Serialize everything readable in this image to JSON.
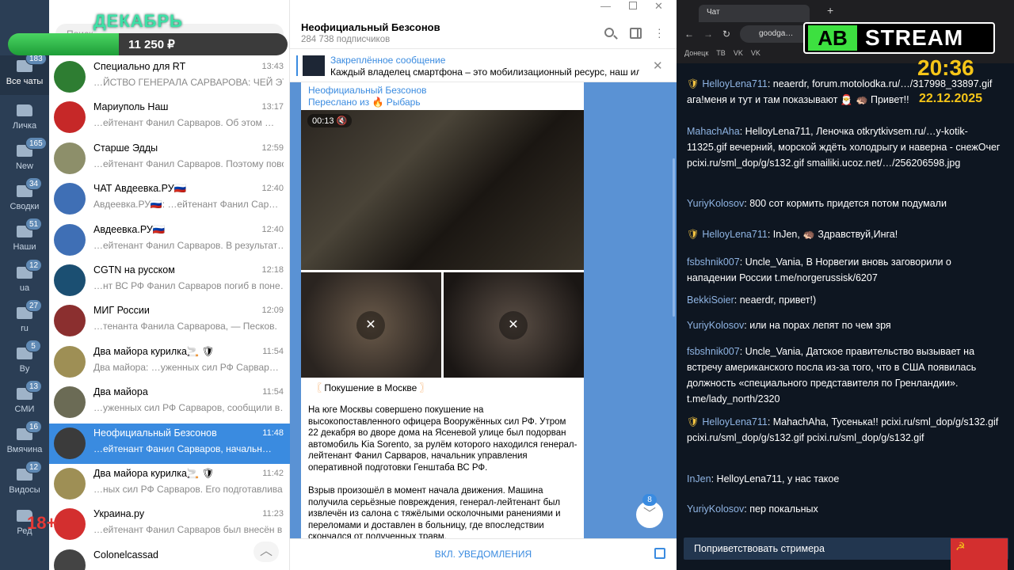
{
  "overlay": {
    "month": "ДЕКАБРЬ",
    "amount": "11 250 ₽",
    "age": "18+",
    "stream_logo_left": "AB",
    "stream_logo_right": "STREAM",
    "clock": "20:36",
    "date": "22.12.2025"
  },
  "folders": [
    {
      "label": "Все чаты",
      "badge": "183"
    },
    {
      "label": "Личка",
      "badge": ""
    },
    {
      "label": "New",
      "badge": "165"
    },
    {
      "label": "Сводки",
      "badge": "34"
    },
    {
      "label": "Наши",
      "badge": "51"
    },
    {
      "label": "ua",
      "badge": "12"
    },
    {
      "label": "ru",
      "badge": "27"
    },
    {
      "label": "By",
      "badge": "5"
    },
    {
      "label": "СМИ",
      "badge": "13"
    },
    {
      "label": "Вмячина",
      "badge": "16"
    },
    {
      "label": "Видосы",
      "badge": "12"
    },
    {
      "label": "Ред",
      "badge": ""
    }
  ],
  "chats": [
    {
      "name": "Специально для RT",
      "time": "13:43",
      "preview": "…ЙСТВО ГЕНЕРАЛА САРВАРОВА: ЧЕЙ ЭТО …",
      "avatar": "#2e7d32"
    },
    {
      "name": "Мариуполь Наш",
      "time": "13:17",
      "preview": "…ейтенант Фанил Сарваров. Об этом …",
      "avatar": "#c62828"
    },
    {
      "name": "Старше Эдды",
      "time": "12:59",
      "preview": "…ейтенант Фанил Сарваров. Поэтому повод…",
      "avatar": "#8d8f6a"
    },
    {
      "name": "ЧАТ Авдеевка.РУ🇷🇺",
      "time": "12:40",
      "preview": "Авдеевка.РУ🇷🇺: …ейтенант Фанил Сар…",
      "avatar": "#3f6fb5"
    },
    {
      "name": "Авдеевка.РУ🇷🇺",
      "time": "12:40",
      "preview": "…ейтенант Фанил Сарваров. В результат…",
      "avatar": "#3f6fb5"
    },
    {
      "name": "CGTN на русском",
      "time": "12:18",
      "preview": "…нт ВС РФ Фанил Сарваров погиб в поне…",
      "avatar": "#1b4f72"
    },
    {
      "name": "МИГ России",
      "time": "12:09",
      "preview": "…тенанта Фанила Сарварова, — Песков.",
      "avatar": "#8b2f2f"
    },
    {
      "name": "Два майора курилка🚬 🛡",
      "time": "11:54",
      "preview": "Два майора: …уженных сил РФ Сарвар…",
      "avatar": "#9e8f55"
    },
    {
      "name": "Два майора",
      "time": "11:54",
      "preview": "…уженных сил РФ Сарваров, сообщили в…",
      "avatar": "#6b6b55"
    },
    {
      "name": "Неофициальный Безсонов",
      "time": "11:48",
      "preview": "…ейтенант Фанил Сарваров, начальн…",
      "avatar": "#3b3b3b"
    },
    {
      "name": "Два майора курилка🚬 🛡",
      "time": "11:42",
      "preview": "…ных сил РФ Сарваров. Его подготавлива…",
      "avatar": "#9e8f55"
    },
    {
      "name": "Украина.ру",
      "time": "11:23",
      "preview": "…ейтенант Фанил Сарваров был внесён в ба…",
      "avatar": "#d32f2f"
    },
    {
      "name": "Colonelcassad",
      "time": "",
      "preview": "",
      "avatar": "#444444"
    }
  ],
  "search_placeholder": "Поиск",
  "channel": {
    "title": "Неофициальный Безсонов",
    "subscribers": "284 738 подписчиков"
  },
  "pinned": {
    "title": "Закреплённое сообщение",
    "text": "Каждый владелец смартфона – это мобилизационный ресурс, наш или …"
  },
  "message": {
    "author": "Неофициальный Безсонов",
    "forwarded": "Переслано из 🔥 Рыбарь",
    "video_time": "00:13",
    "headline": "Покушение в Москве",
    "p1": "На юге Москвы совершено покушение на высокопоставленного офицера Вооружённых сил РФ. Утром 22 декабря во дворе дома на Ясеневой улице был подорван автомобиль Kia Sorento, за рулём которого находился генерал-лейтенант Фанил Сарваров, начальник управления оперативной подготовки Генштаба ВС РФ.",
    "p2": "Взрыв произошёл в момент начала движения. Машина получила серьёзные повреждения, генерал-лейтенант был извлечён из салона с тяжёлыми осколочными ранениями и переломами и доставлен в больницу, где впоследствии скончался от полученных травм."
  },
  "unread_count": "8",
  "notify_button": "ВКЛ. УВЕДОМЛЕНИЯ",
  "browser": {
    "tab_title": "Чат",
    "url": "goodga…",
    "bookmarks": [
      "Донецк",
      "ТВ",
      "VK",
      "VK"
    ]
  },
  "stream_chat": [
    {
      "nick": "HelloyLena711",
      "badge": true,
      "text": "neaerdr, forum.motolodka.ru/…/317998_33897.gif ага!меня и тут и там показывают 🎅 🦔 Привет!!"
    },
    {
      "nick": "MahachAha",
      "badge": false,
      "text": "HelloyLena711, Леночка otkrytkivsem.ru/…y-kotik-11325.gif вечерний, морской ждёть холодрыгу и наверна - снежОчег pcixi.ru/sml_dop/g/s132.gif smailiki.ucoz.net/…/256206598.jpg"
    },
    {
      "nick": "YuriyKolosov",
      "badge": false,
      "text": "800 сот кормить придется потом подумали"
    },
    {
      "nick": "HelloyLena711",
      "badge": true,
      "text": "InJen, 🦔 Здравствуй,Инга!"
    },
    {
      "nick": "fsbshnik007",
      "badge": false,
      "text": "Uncle_Vania, В Норвегии вновь заговорили о нападении России t.me/norgerussisk/6207"
    },
    {
      "nick": "BekkiSoier",
      "badge": false,
      "text": "neaerdr, привет!)"
    },
    {
      "nick": "YuriyKolosov",
      "badge": false,
      "text": "или на порах лепят по чем зря"
    },
    {
      "nick": "fsbshnik007",
      "badge": false,
      "text": "Uncle_Vania, Датское правительство вызывает на встречу американского посла из-за того, что в США появилась должность «специального представителя по Гренландии». t.me/lady_north/2320"
    },
    {
      "nick": "HelloyLena711",
      "badge": true,
      "text": "MahachAha, Тусенька!! pcixi.ru/sml_dop/g/s132.gif pcixi.ru/sml_dop/g/s132.gif pcixi.ru/sml_dop/g/s132.gif"
    },
    {
      "nick": "InJen",
      "badge": false,
      "text": "HelloyLena711, у нас такое"
    },
    {
      "nick": "YuriyKolosov",
      "badge": false,
      "text": "пер покальных"
    }
  ],
  "greet_button": "Поприветствовать стримера"
}
